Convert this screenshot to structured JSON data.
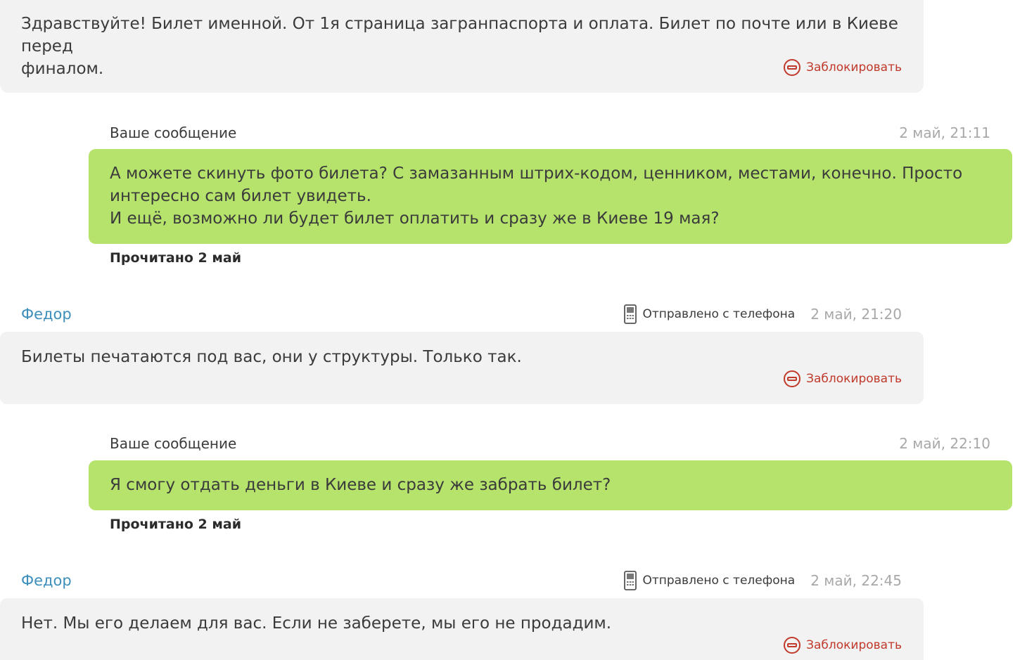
{
  "messages": [
    {
      "type": "incoming",
      "text": "Здравствуйте! Билет именной. От 1я страница загранпаспорта и оплата. Билет по почте или в Киеве перед\nфиналом.",
      "block_label": "Заблокировать"
    },
    {
      "type": "outgoing",
      "label": "Ваше сообщение",
      "time": "2 май, 21:11",
      "text": "А можете скинуть фото билета? С замазанным штрих-кодом, ценником, местами, конечно. Просто\nинтересно сам билет увидеть.\nИ ещё, возможно ли будет билет оплатить и сразу же в Киеве 19 мая?",
      "read_status": "Прочитано 2 май"
    },
    {
      "type": "incoming",
      "sender": "Федор",
      "sent_from": "Отправлено с телефона",
      "time": "2 май, 21:20",
      "text": "Билеты печатаются под вас, они у структуры. Только так.",
      "block_label": "Заблокировать"
    },
    {
      "type": "outgoing",
      "label": "Ваше сообщение",
      "time": "2 май, 22:10",
      "text": "Я смогу отдать деньги в Киеве и сразу же забрать билет?",
      "read_status": "Прочитано 2 май"
    },
    {
      "type": "incoming",
      "sender": "Федор",
      "sent_from": "Отправлено с телефона",
      "time": "2 май, 22:45",
      "text": "Нет. Мы его делаем для вас. Если не заберете, мы его не продадим.",
      "block_label": "Заблокировать"
    }
  ],
  "icons": {
    "block": "block-icon",
    "phone": "phone-icon"
  },
  "colors": {
    "incoming_bg": "#f2f2f2",
    "outgoing_bg": "#b5e36b",
    "sender": "#3d8fbc",
    "block_link": "#c0392b",
    "timestamp": "#a8a8a8"
  }
}
